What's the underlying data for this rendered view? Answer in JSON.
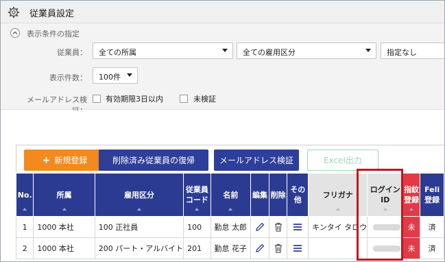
{
  "window": {
    "title": "従業員設定",
    "icon": "gear-icon"
  },
  "filter": {
    "heading": "表示条件の指定",
    "toggle_icon": "chevron-up-icon",
    "employee_label": "従業員：",
    "affiliation_value": "全ての所属",
    "employment_value": "全ての雇用区分",
    "extra_value": "指定なし",
    "count_label": "表示件数：",
    "count_value": "100件",
    "mail_label": "メールアドレス検証：",
    "mail_options": [
      "有効期限3日以内",
      "未検証"
    ]
  },
  "toolbar": {
    "new_label": "新規登録",
    "restore_label": "削除済み従業員の復帰",
    "verify_label": "メールアドレス検証",
    "excel_label": "Excel出力"
  },
  "table": {
    "headers": {
      "no": "No.",
      "affiliation": "所属",
      "employment": "雇用区分",
      "code_line1": "従業員",
      "code_line2": "コード",
      "name": "名前",
      "edit": "編集",
      "delete": "削除",
      "other": "その他",
      "furigana": "フリガナ",
      "login_id": "ログインID",
      "finger_line1": "指紋",
      "finger_line2": "登録",
      "felica_line1": "Feli",
      "felica_line2": "登録"
    },
    "rows": [
      {
        "no": "1",
        "affiliation": "1000 本社",
        "employment": "100 正社員",
        "code": "100",
        "name": "勤怠 太郎",
        "furigana": "キンタイ タロウ",
        "finger": "未",
        "felica": "済"
      },
      {
        "no": "2",
        "affiliation": "1000 本社",
        "employment": "200 パート・アルバイト",
        "code": "201",
        "name": "勤怠 花子",
        "furigana": "",
        "finger": "未",
        "felica": "済"
      }
    ]
  },
  "colors": {
    "header_bg": "#2c3b92",
    "orange": "#f28a1e",
    "unregistered_red": "#e13a45",
    "highlight_red": "#c0181f"
  }
}
